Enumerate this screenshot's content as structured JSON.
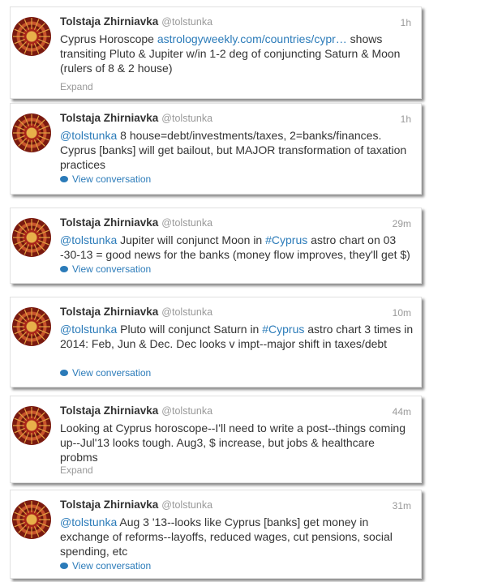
{
  "tweets": [
    {
      "name": "Tolstaja Zhirniavka",
      "handle": "@tolstunka",
      "time": "1h",
      "parts": [
        "Cyprus Horoscope ",
        "astrologyweekly.com/countries/cypr…",
        " shows transiting  Pluto & Jupiter w/in 1-2 deg of conjuncting Saturn & Moon (rulers of 8 & 2 house)"
      ],
      "action": "Expand"
    },
    {
      "name": "Tolstaja Zhirniavka",
      "handle": "@tolstunka",
      "time": "1h",
      "parts": [
        "@tolstunka",
        " 8 house=debt/investments/taxes, 2=banks/finances. Cyprus [banks] will get bailout, but MAJOR transformation of taxation practices"
      ],
      "action": "View conversation"
    },
    {
      "name": "Tolstaja Zhirniavka",
      "handle": "@tolstunka",
      "time": "29m",
      "parts": [
        "@tolstunka",
        " Jupiter will conjunct Moon in ",
        "#Cyprus",
        " astro chart on 03 -30-13 = good news for the banks (money flow improves, they'll get $)"
      ],
      "action": "View conversation"
    },
    {
      "name": "Tolstaja Zhirniavka",
      "handle": "@tolstunka",
      "time": "10m",
      "parts": [
        "@tolstunka",
        " Pluto will conjunct Saturn in ",
        "#Cyprus",
        " astro chart 3 times in 2014: Feb, Jun & Dec. Dec looks v impt--major shift in taxes/debt"
      ],
      "action": "View conversation"
    },
    {
      "name": "Tolstaja Zhirniavka",
      "handle": "@tolstunka",
      "time": "44m",
      "parts": [
        "Looking at Cyprus horoscope--I'll need to write a post--things coming up--Jul'13 looks tough. Aug3, $ increase, but jobs & healthcare probms"
      ],
      "action": "Expand"
    },
    {
      "name": "Tolstaja Zhirniavka",
      "handle": "@tolstunka",
      "time": "31m",
      "parts": [
        "@tolstunka",
        " Aug 3 '13--looks like Cyprus [banks] get money in exchange of reforms--layoffs, reduced wages, cut pensions, social spending, etc"
      ],
      "action": "View conversation"
    }
  ],
  "colors": {
    "link": "#2b7bb9",
    "meta": "#999999",
    "text": "#333333"
  },
  "icons": {
    "conversation": "speech-bubble-icon",
    "avatar": "aztec-sun-stone-avatar"
  }
}
